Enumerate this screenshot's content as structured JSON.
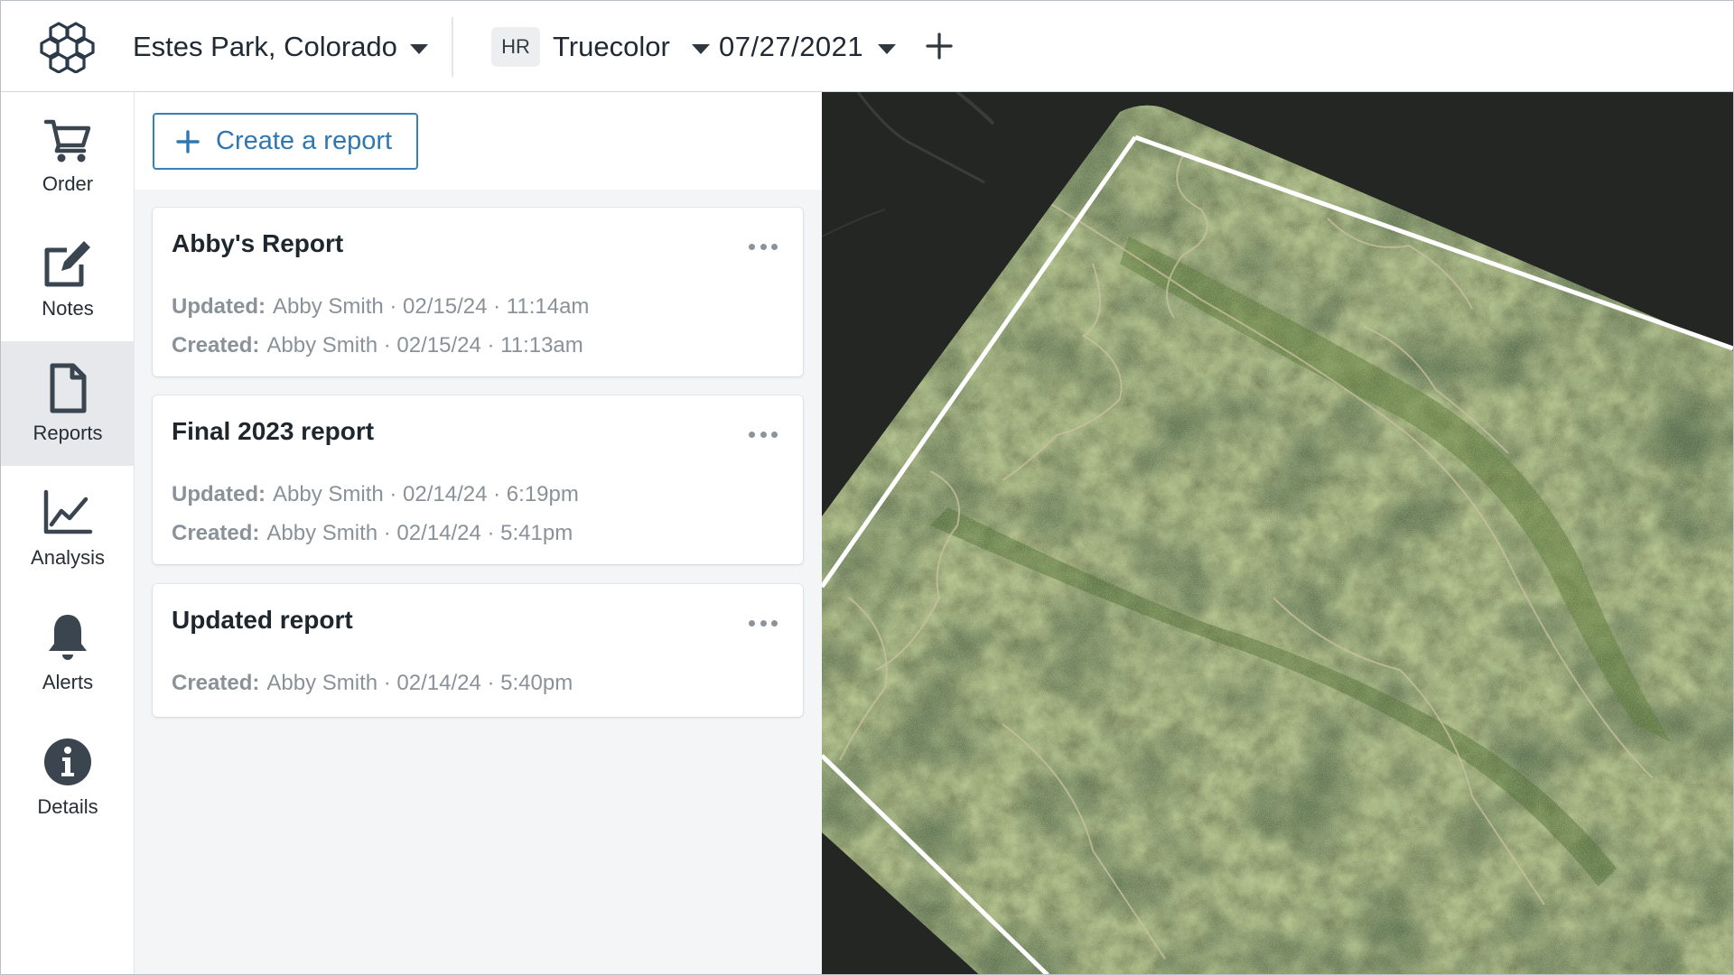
{
  "header": {
    "location": "Estes Park, Colorado",
    "layer_badge": "HR",
    "layer_name": "Truecolor",
    "date": "07/27/2021"
  },
  "nav": {
    "items": [
      {
        "label": "Order",
        "icon": "cart-icon"
      },
      {
        "label": "Notes",
        "icon": "edit-note-icon"
      },
      {
        "label": "Reports",
        "icon": "document-icon",
        "active": true
      },
      {
        "label": "Analysis",
        "icon": "line-chart-icon"
      },
      {
        "label": "Alerts",
        "icon": "bell-icon"
      },
      {
        "label": "Details",
        "icon": "info-icon"
      }
    ]
  },
  "panel": {
    "create_label": "Create a report",
    "reports": [
      {
        "title": "Abby's Report",
        "updated_label": "Updated:",
        "updated_value": "Abby Smith · 02/15/24 · 11:14am",
        "created_label": "Created:",
        "created_value": "Abby Smith · 02/15/24 · 11:13am"
      },
      {
        "title": "Final 2023 report",
        "updated_label": "Updated:",
        "updated_value": "Abby Smith · 02/14/24 · 6:19pm",
        "created_label": "Created:",
        "created_value": "Abby Smith · 02/14/24 · 5:41pm"
      },
      {
        "title": "Updated report",
        "created_label": "Created:",
        "created_value": "Abby Smith · 02/14/24 · 5:40pm"
      }
    ]
  },
  "colors": {
    "accent": "#2f77b0",
    "nav_active_bg": "#e6e8eb",
    "panel_bg": "#f4f5f7",
    "map_outline": "#ffffff"
  }
}
